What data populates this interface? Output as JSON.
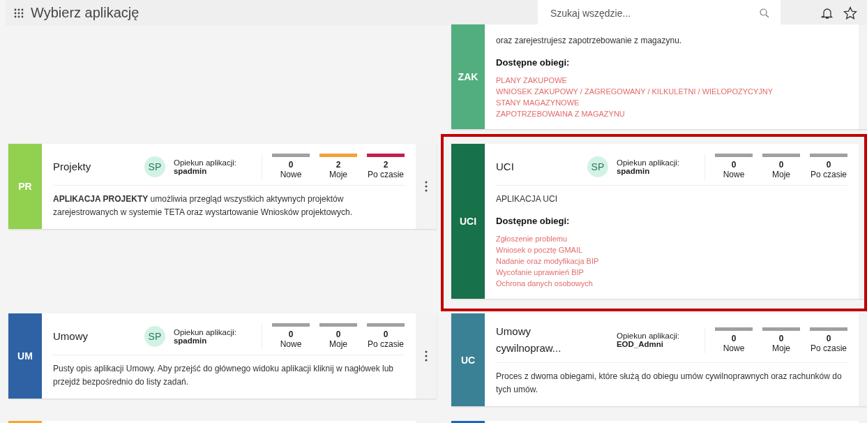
{
  "header": {
    "title": "Wybierz aplikację",
    "search_placeholder": "Szukaj wszędzie..."
  },
  "rows": [
    {
      "cells": [
        null,
        {
          "abbr": "ZAK",
          "color": "#52ae7f",
          "highlighted": false,
          "description": "oraz zarejestrujesz zapotrzebowanie z magazynu.",
          "flows_heading": "Dostępne obiegi:",
          "flows": [
            "PLANY ZAKUPOWE",
            "WNIOSEK ZAKUPOWY / ZAGREGOWANY / KILKULETNI / WIELOPOZYCYJNY",
            "STANY MAGAZYNOWE",
            "ZAPOTRZEBOWAINA Z MAGAZYNU"
          ]
        }
      ]
    },
    {
      "cells": [
        {
          "abbr": "PR",
          "color": "#92d050",
          "highlighted": false,
          "menu": true,
          "title": "Projekty",
          "avatar": "SP",
          "owner_label": "Opiekun aplikacji:",
          "owner": "spadmin",
          "stats": [
            {
              "value": "0",
              "label": "Nowe",
              "color": "#a0a0a0"
            },
            {
              "value": "2",
              "label": "Moje",
              "color": "#f2a23c"
            },
            {
              "value": "2",
              "label": "Po czasie",
              "color": "#c0214b"
            }
          ],
          "description": "**APLIKACJA PROJEKTY** umożliwia przegląd wszystkich aktywnych projektów zarejestrowanych w systemie TETA oraz wystartowanie Wniosków projektowych."
        },
        {
          "abbr": "UCI",
          "color": "#17714a",
          "highlighted": true,
          "title": "UCI",
          "avatar": "SP",
          "owner_label": "Opiekun aplikacji:",
          "owner": "spadmin",
          "stats": [
            {
              "value": "0",
              "label": "Nowe",
              "color": "#a0a0a0"
            },
            {
              "value": "0",
              "label": "Moje",
              "color": "#a0a0a0"
            },
            {
              "value": "0",
              "label": "Po czasie",
              "color": "#a0a0a0"
            }
          ],
          "description": "APLIKACJA UCI",
          "flows_heading": "Dostępne obiegi:",
          "flows": [
            "Zgłoszenie problemu",
            "Wniosek o pocztę GMAIL",
            "Nadanie oraz modyfikacja BIP",
            "Wycofanie uprawnień BIP",
            "Ochrona danych osobowych"
          ]
        }
      ]
    },
    {
      "cells": [
        {
          "abbr": "UM",
          "color": "#2e62a4",
          "highlighted": false,
          "menu": true,
          "title": "Umowy",
          "avatar": "SP",
          "owner_label": "Opiekun aplikacji:",
          "owner": "spadmin",
          "stats": [
            {
              "value": "0",
              "label": "Nowe",
              "color": "#a0a0a0"
            },
            {
              "value": "0",
              "label": "Moje",
              "color": "#a0a0a0"
            },
            {
              "value": "0",
              "label": "Po czasie",
              "color": "#a0a0a0"
            }
          ],
          "description": "Pusty opis aplikacji Umowy. Aby przejść do głównego widoku aplikacji kliknij w nagłówek lub przejdź bezpośrednio do listy zadań."
        },
        {
          "abbr": "UC",
          "color": "#3b8196",
          "highlighted": false,
          "title": "Umowy cywilnopraw...",
          "owner_label": "Opiekun aplikacji:",
          "owner": "EOD_Admni",
          "stats": [
            {
              "value": "0",
              "label": "Nowe",
              "color": "#a0a0a0"
            },
            {
              "value": "0",
              "label": "Moje",
              "color": "#a0a0a0"
            },
            {
              "value": "0",
              "label": "Po czasie",
              "color": "#a0a0a0"
            }
          ],
          "description": "Proces z dwoma obiegami, które służą do obiegu umów cywilnoprawnych oraz rachunków do tych umów."
        }
      ]
    },
    {
      "cells": [
        {
          "color": "#f9a430",
          "highlighted": false
        },
        {
          "color": "#1669c0",
          "highlighted": false
        }
      ]
    }
  ]
}
